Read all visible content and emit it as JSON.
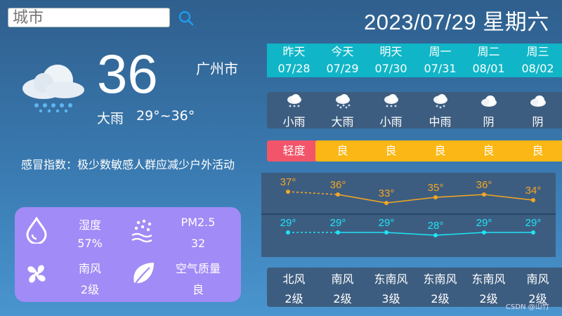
{
  "search": {
    "placeholder": "城市"
  },
  "header": {
    "date_title": "2023/07/29 星期六"
  },
  "current": {
    "temp": "36",
    "city": "广州市",
    "desc": "大雨",
    "range": "29°~36°",
    "icon": "heavy-rain-icon"
  },
  "cold_index": "感冒指数：极少数敏感人群应减少户外活动",
  "info": {
    "humidity_label": "湿度",
    "humidity_value": "57%",
    "pm25_label": "PM2.5",
    "pm25_value": "32",
    "wind_label": "南风",
    "wind_level": "2级",
    "aqi_label": "空气质量",
    "aqi_value": "良",
    "card_color": "#a18bf6"
  },
  "forecast": [
    {
      "label": "昨天",
      "date": "07/28",
      "weather": "小雨",
      "aqi": "轻度",
      "aqi_color": "#f2556a",
      "wind_dir": "北风",
      "wind_level": "2级",
      "icon": "light-rain-icon"
    },
    {
      "label": "今天",
      "date": "07/29",
      "weather": "大雨",
      "aqi": "良",
      "aqi_color": "#fbb715",
      "wind_dir": "南风",
      "wind_level": "2级",
      "icon": "heavy-rain-icon"
    },
    {
      "label": "明天",
      "date": "07/30",
      "weather": "小雨",
      "aqi": "良",
      "aqi_color": "#fbb715",
      "wind_dir": "东南风",
      "wind_level": "3级",
      "icon": "light-rain-icon"
    },
    {
      "label": "周一",
      "date": "07/31",
      "weather": "中雨",
      "aqi": "良",
      "aqi_color": "#fbb715",
      "wind_dir": "东南风",
      "wind_level": "2级",
      "icon": "moderate-rain-icon"
    },
    {
      "label": "周二",
      "date": "08/01",
      "weather": "阴",
      "aqi": "良",
      "aqi_color": "#fbb715",
      "wind_dir": "东南风",
      "wind_level": "2级",
      "icon": "overcast-icon"
    },
    {
      "label": "周三",
      "date": "08/02",
      "weather": "阴",
      "aqi": "良",
      "aqi_color": "#fbb715",
      "wind_dir": "南风",
      "wind_level": "2级",
      "icon": "overcast-icon"
    }
  ],
  "chart_data": {
    "type": "line",
    "categories": [
      "07/28",
      "07/29",
      "07/30",
      "07/31",
      "08/01",
      "08/02"
    ],
    "series": [
      {
        "values": [
          37,
          36,
          33,
          35,
          36,
          34
        ],
        "color": "#f4a622"
      },
      {
        "values": [
          29,
          29,
          29,
          28,
          29,
          29
        ],
        "color": "#1fe4f4"
      }
    ],
    "unit": "°"
  },
  "watermark": "CSDN @山竹"
}
